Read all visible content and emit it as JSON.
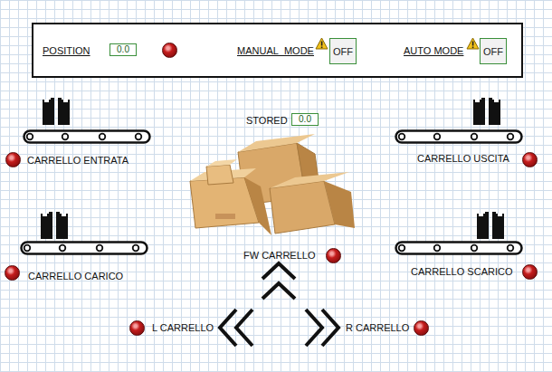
{
  "status_panel": {
    "position": {
      "label": "POSITION",
      "value": "0.0",
      "led_on": false
    },
    "manual_mode": {
      "label": "MANUAL_MODE",
      "button": "OFF",
      "on": false
    },
    "auto_mode": {
      "label": "AUTO MODE",
      "button": "OFF",
      "on": false
    }
  },
  "stored": {
    "label": "STORED",
    "value": "0.0"
  },
  "carts": [
    {
      "label": "CARRELLO ENTRATA",
      "led_on": false
    },
    {
      "label": "CARRELLO CARICO",
      "led_on": false
    },
    {
      "label": "CARRELLO USCITA",
      "led_on": false
    },
    {
      "label": "CARRELLO SCARICO",
      "led_on": false
    }
  ],
  "controls": [
    {
      "label": "FW CARRELLO",
      "kind": "forward",
      "led_on": false
    },
    {
      "label": "L CARRELLO",
      "kind": "left",
      "led_on": false
    },
    {
      "label": "R CARRELLO",
      "kind": "right",
      "led_on": false
    }
  ]
}
